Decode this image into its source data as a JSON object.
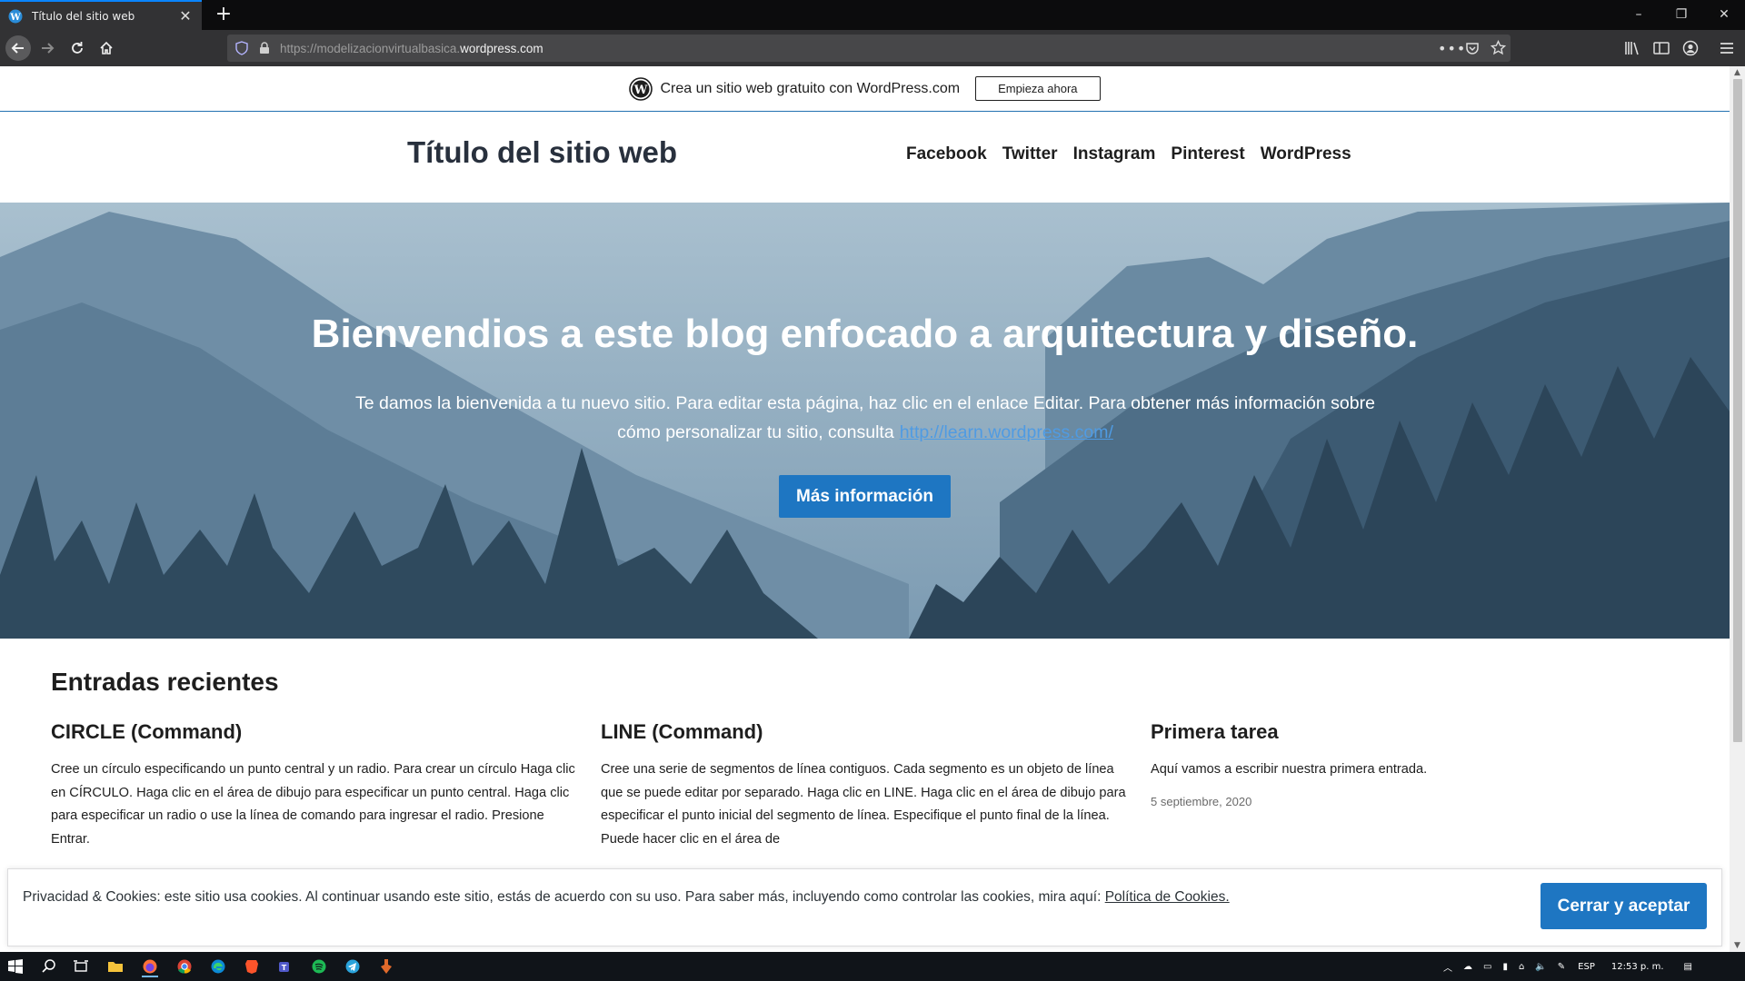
{
  "browser": {
    "tab_title": "Título del sitio web",
    "new_tab_icon": "plus-icon",
    "url_prefix": "https://modelizacionvirtualbasica.",
    "url_domain": "wordpress.com",
    "window_controls": [
      "–",
      "❐",
      "✕"
    ]
  },
  "wp_banner": {
    "text": "Crea un sitio web gratuito con WordPress.com",
    "button": "Empieza ahora"
  },
  "header": {
    "site_title": "Título del sitio web",
    "nav": [
      "Facebook",
      "Twitter",
      "Instagram",
      "Pinterest",
      "WordPress"
    ]
  },
  "hero": {
    "title": "Bienvendios a este blog enfocado a arquitectura y diseño.",
    "description": "Te damos la bienvenida a tu nuevo sitio. Para editar esta página, haz clic en el enlace Editar. Para obtener más información sobre cómo personalizar tu sitio, consulta",
    "link": "http://learn.wordpress.com/",
    "button": "Más información"
  },
  "posts": {
    "heading": "Entradas recientes",
    "items": [
      {
        "title": "CIRCLE (Command)",
        "excerpt": "Cree un círculo especificando un punto central y un radio. Para crear un círculo Haga clic en CÍRCULO. Haga clic en el área de dibujo para especificar un punto central. Haga clic para especificar un radio o use la línea de comando para ingresar el radio. Presione Entrar.",
        "date": ""
      },
      {
        "title": "LINE (Command)",
        "excerpt": "Cree una serie de segmentos de línea contiguos. Cada segmento es un objeto de lí­nea que se puede editar por separado. Haga clic en LINE. Haga clic en el área de di­bujo para especificar el punto inicial del segmento de línea. Especifique el punto fi­nal de la línea. Puede hacer clic en el área de",
        "date": ""
      },
      {
        "title": "Primera tarea",
        "excerpt": "Aquí vamos a escribir nuestra primera entrada.",
        "date": "5 septiembre, 2020"
      }
    ]
  },
  "cookie": {
    "text": "Privacidad & Cookies: este sitio usa cookies. Al continuar usando este sitio, estás de acuerdo con su uso. Para saber más, incluyendo como controlar las cookies, mira aquí:",
    "link": "Política de Cookies.",
    "button": "Cerrar y aceptar"
  },
  "taskbar": {
    "language": "ESP",
    "time": "12:53 p. m."
  },
  "colors": {
    "accent": "#1e76c2",
    "browser_dark": "#323234",
    "hero_sky": "#9cb7c8"
  }
}
